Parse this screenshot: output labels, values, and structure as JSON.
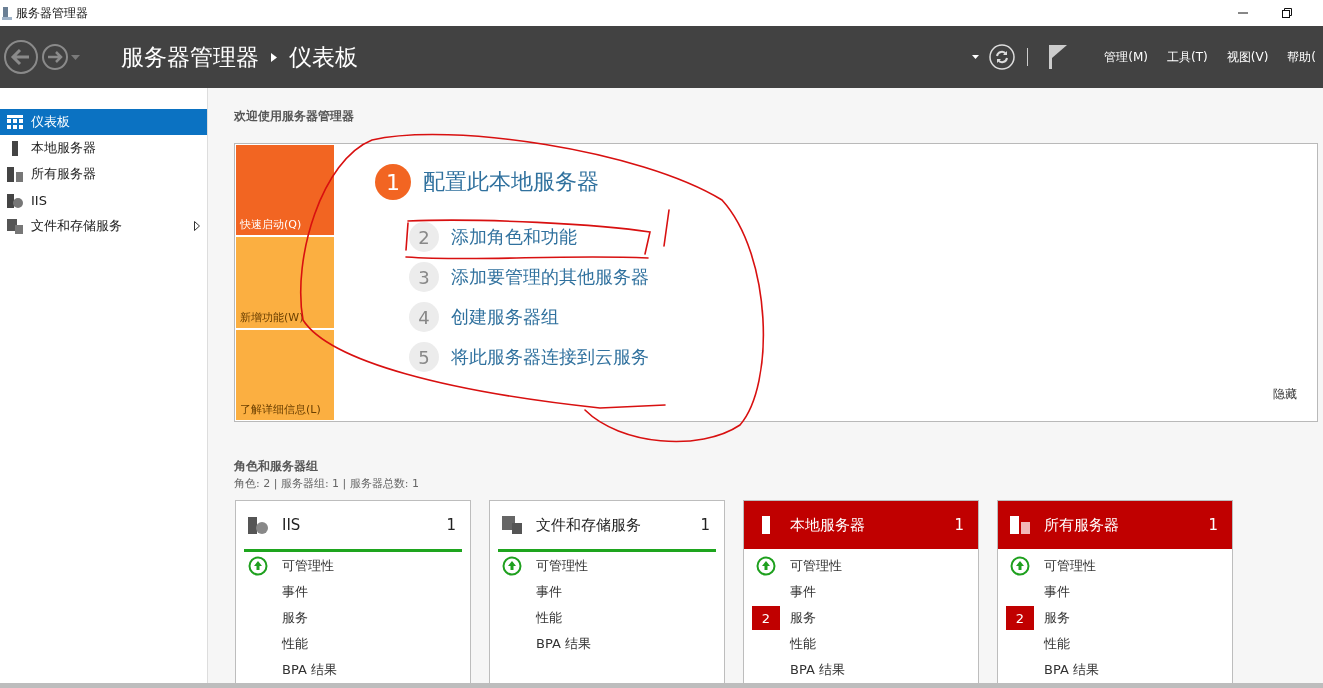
{
  "window": {
    "title": "服务器管理器"
  },
  "header": {
    "title": "服务器管理器",
    "page": "仪表板",
    "menus": [
      "管理(M)",
      "工具(T)",
      "视图(V)",
      "帮助("
    ]
  },
  "sidebar": {
    "items": [
      {
        "label": "仪表板",
        "selected": true,
        "expandable": false
      },
      {
        "label": "本地服务器",
        "selected": false,
        "expandable": false
      },
      {
        "label": "所有服务器",
        "selected": false,
        "expandable": false
      },
      {
        "label": "IIS",
        "selected": false,
        "expandable": false
      },
      {
        "label": "文件和存储服务",
        "selected": false,
        "expandable": true
      }
    ]
  },
  "welcome": {
    "heading": "欢迎使用服务器管理器",
    "tiles": [
      {
        "label": "快速启动(Q)",
        "selected": true
      },
      {
        "label": "新增功能(W)",
        "selected": false
      },
      {
        "label": "了解详细信息(L)",
        "selected": false
      }
    ],
    "steps": [
      {
        "number": "1",
        "label": "配置此本地服务器",
        "kind": "current"
      },
      {
        "number": "2",
        "label": "添加角色和功能",
        "kind": "pending"
      },
      {
        "number": "3",
        "label": "添加要管理的其他服务器",
        "kind": "pending"
      },
      {
        "number": "4",
        "label": "创建服务器组",
        "kind": "pending"
      },
      {
        "number": "5",
        "label": "将此服务器连接到云服务",
        "kind": "pending"
      }
    ],
    "hide": "隐藏"
  },
  "roles": {
    "heading": "角色和服务器组",
    "summary": "角色: 2 | 服务器组: 1 | 服务器总数: 1",
    "cards": [
      {
        "title": "IIS",
        "count": "1",
        "alert": false,
        "rows": [
          {
            "kind": "ok",
            "label": "可管理性"
          },
          {
            "kind": "plain",
            "label": "事件"
          },
          {
            "kind": "plain",
            "label": "服务"
          },
          {
            "kind": "plain",
            "label": "性能"
          },
          {
            "kind": "plain",
            "label": "BPA 结果"
          }
        ]
      },
      {
        "title": "文件和存储服务",
        "count": "1",
        "alert": false,
        "rows": [
          {
            "kind": "ok",
            "label": "可管理性"
          },
          {
            "kind": "plain",
            "label": "事件"
          },
          {
            "kind": "plain",
            "label": "性能"
          },
          {
            "kind": "plain",
            "label": "BPA 结果"
          }
        ]
      },
      {
        "title": "本地服务器",
        "count": "1",
        "alert": true,
        "rows": [
          {
            "kind": "ok",
            "label": "可管理性"
          },
          {
            "kind": "plain",
            "label": "事件"
          },
          {
            "kind": "alert",
            "label": "服务",
            "badge": "2"
          },
          {
            "kind": "plain",
            "label": "性能"
          },
          {
            "kind": "plain",
            "label": "BPA 结果"
          }
        ]
      },
      {
        "title": "所有服务器",
        "count": "1",
        "alert": true,
        "rows": [
          {
            "kind": "ok",
            "label": "可管理性"
          },
          {
            "kind": "plain",
            "label": "事件"
          },
          {
            "kind": "alert",
            "label": "服务",
            "badge": "2"
          },
          {
            "kind": "plain",
            "label": "性能"
          },
          {
            "kind": "plain",
            "label": "BPA 结果"
          }
        ]
      }
    ]
  }
}
